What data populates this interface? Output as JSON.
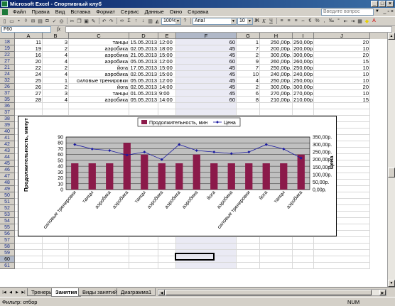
{
  "window": {
    "title": "Microsoft Excel - Спортивный клуб"
  },
  "menu": [
    "Файл",
    "Правка",
    "Вид",
    "Вставка",
    "Формат",
    "Сервис",
    "Данные",
    "Окно",
    "Справка"
  ],
  "ask_placeholder": "Введите вопрос",
  "toolbar": {
    "zoom": "100%",
    "font": "Arial",
    "size": "10",
    "bold": "Ж",
    "italic": "К",
    "underline": "Ч"
  },
  "formula": {
    "namebox": "F60",
    "fx": "fx",
    "value": ""
  },
  "columns": [
    "A",
    "B",
    "C",
    "D",
    "E",
    "F",
    "G",
    "H",
    "I",
    "J"
  ],
  "row_numbers": [
    "18",
    "19",
    "22",
    "27",
    "21",
    "24",
    "32",
    "26",
    "37",
    "35",
    "36",
    "37",
    "38",
    "39",
    "40",
    "41",
    "42",
    "43",
    "44",
    "45",
    "46",
    "47",
    "48",
    "49",
    "50",
    "51",
    "52",
    "53",
    "54",
    "55",
    "56",
    "57",
    "58",
    "59",
    "60",
    "61"
  ],
  "data_rows": [
    [
      "11",
      "3",
      "танцы",
      "15.05.2013",
      "12:00",
      "60",
      "1",
      "250,00р.",
      "250,00р.",
      "20"
    ],
    [
      "19",
      "2",
      "аэробика",
      "02.05.2013",
      "18:00",
      "45",
      "7",
      "200,00р.",
      "200,00р.",
      "10"
    ],
    [
      "16",
      "4",
      "аэробика",
      "21.05.2013",
      "15:00",
      "45",
      "2",
      "300,00р.",
      "300,00р.",
      "20"
    ],
    [
      "20",
      "4",
      "аэробика",
      "05.05.2013",
      "12:00",
      "60",
      "9",
      "260,00р.",
      "260,00р.",
      "15"
    ],
    [
      "22",
      "2",
      "йога",
      "17.05.2013",
      "15:00",
      "45",
      "7",
      "250,00р.",
      "250,00р.",
      "10"
    ],
    [
      "24",
      "4",
      "аэробика",
      "02.05.2013",
      "15:00",
      "45",
      "10",
      "240,00р.",
      "240,00р.",
      "10"
    ],
    [
      "25",
      "1",
      "силовые тренировки",
      "05.05.2013",
      "12:00",
      "45",
      "4",
      "250,00р.",
      "250,00р.",
      "10"
    ],
    [
      "26",
      "2",
      "йога",
      "02.05.2013",
      "14:00",
      "45",
      "2",
      "300,00р.",
      "300,00р.",
      "20"
    ],
    [
      "27",
      "3",
      "танцы",
      "01.05.2013",
      "9:00",
      "45",
      "6",
      "270,00р.",
      "270,00р.",
      "10"
    ],
    [
      "28",
      "4",
      "аэробика",
      "05.05.2013",
      "14:00",
      "60",
      "8",
      "210,00р.",
      "210,00р.",
      "15"
    ]
  ],
  "sheets": [
    "Тренеры",
    "Занятия",
    "Виды занятий",
    "Диаграмма1"
  ],
  "active_sheet": "Занятия",
  "status": {
    "left": "Фильтр: отбор",
    "right": "NUM"
  },
  "colors": {
    "bar": "#8b1a4a",
    "line": "#1a1aa0",
    "plot_bg": "#c0c0c0",
    "title_bar": "#0a246a"
  },
  "chart_data": {
    "type": "bar",
    "categories": [
      "силовые тренировки",
      "танцы",
      "аэробика",
      "аэробика",
      "танцы",
      "аэробика",
      "аэробика",
      "аэробика",
      "йога",
      "аэробика",
      "силовые тренировки",
      "йога",
      "танцы",
      "аэробика"
    ],
    "series": [
      {
        "name": "Продолжительность, мин",
        "type": "bar",
        "axis": "left",
        "values": [
          45,
          45,
          45,
          80,
          60,
          45,
          45,
          60,
          45,
          45,
          45,
          45,
          45,
          60
        ]
      },
      {
        "name": "Цена",
        "type": "line",
        "axis": "right",
        "values": [
          300,
          270,
          260,
          230,
          250,
          200,
          300,
          260,
          250,
          240,
          250,
          300,
          270,
          210
        ]
      }
    ],
    "ylabel": "Продолжительность, минут",
    "y2label": "Цена",
    "ylim": [
      0,
      90
    ],
    "y2lim": [
      0,
      350
    ],
    "yticks": [
      "0",
      "10",
      "20",
      "30",
      "40",
      "50",
      "60",
      "70",
      "80",
      "90"
    ],
    "y2ticks": [
      "0,00р.",
      "50,00р.",
      "100,00р.",
      "150,00р.",
      "200,00р.",
      "250,00р.",
      "300,00р.",
      "350,00р."
    ],
    "legend": "top",
    "grid": true
  }
}
